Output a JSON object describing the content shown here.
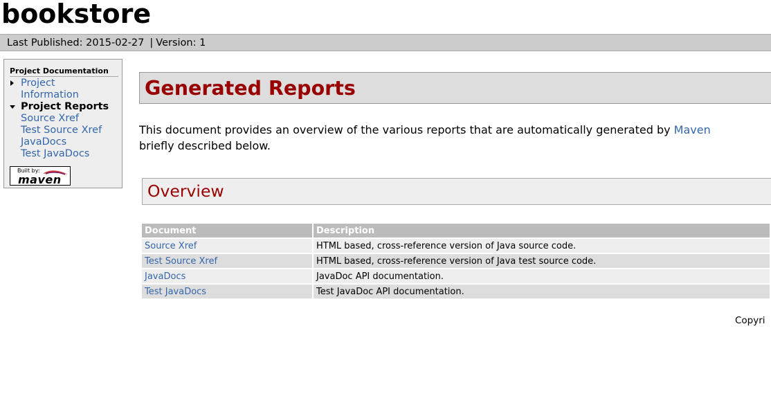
{
  "site": {
    "title": "bookstore"
  },
  "breadcrumbs": {
    "published": "Last Published: 2015-02-27",
    "separator": "|",
    "version": "Version: 1"
  },
  "nav": {
    "heading": "Project Documentation",
    "items": [
      {
        "label_line1": "Project",
        "label_line2": "Information",
        "expanded": false
      },
      {
        "label": "Project Reports",
        "expanded": true,
        "children": [
          "Source Xref",
          "Test Source Xref",
          "JavaDocs",
          "Test JavaDocs"
        ]
      }
    ],
    "badge": {
      "built_by": "Built by:",
      "name": "maven"
    }
  },
  "main": {
    "title": "Generated Reports",
    "intro_line1": "This document provides an overview of the various reports that are automatically generated by ",
    "intro_link": "Maven",
    "intro_line2": "briefly described below.",
    "overview_title": "Overview",
    "table": {
      "headers": [
        "Document",
        "Description"
      ],
      "rows": [
        {
          "document": "Source Xref",
          "description": "HTML based, cross-reference version of Java source code."
        },
        {
          "document": "Test Source Xref",
          "description": "HTML based, cross-reference version of Java test source code."
        },
        {
          "document": "JavaDocs",
          "description": "JavaDoc API documentation."
        },
        {
          "document": "Test JavaDocs",
          "description": "Test JavaDoc API documentation."
        }
      ]
    }
  },
  "footer": {
    "copyright": "Copyri"
  },
  "colors": {
    "link": "#3366aa",
    "title_red": "#990000",
    "breadcrumb_bg": "#cccccc",
    "table_header_bg": "#bbbbbb"
  }
}
